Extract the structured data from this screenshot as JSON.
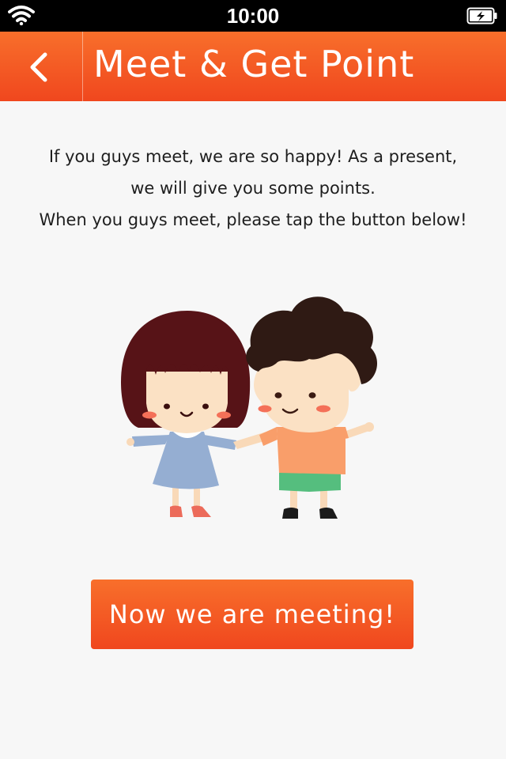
{
  "status_bar": {
    "time": "10:00",
    "wifi_icon": "wifi-icon",
    "battery_icon": "battery-charging-icon"
  },
  "nav": {
    "title": "Meet & Get Point",
    "back_icon": "chevron-left-icon"
  },
  "intro": {
    "lines": [
      "If you guys meet, we are so happy! As a present,",
      "we will give you some points.",
      "When you guys meet, please tap the button below!"
    ]
  },
  "illustration": {
    "subject": "girl-and-boy-holding-hands"
  },
  "action": {
    "button_label": "Now we are meeting!"
  },
  "colors": {
    "accent": "#f55a23",
    "status_bar": "#000000",
    "background": "#f7f7f7"
  }
}
